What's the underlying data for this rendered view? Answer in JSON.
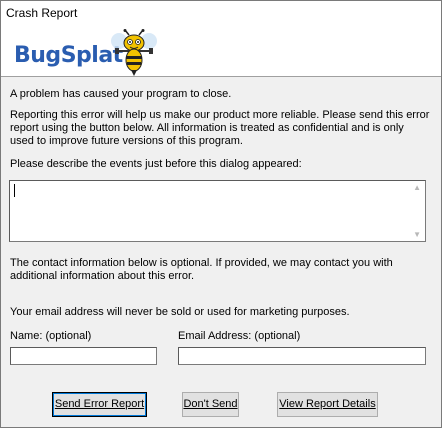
{
  "window": {
    "title": "Crash Report"
  },
  "header": {
    "logo_part1": "Bug",
    "logo_part2": "Splat",
    "mascot_icon": "bee-mascot-icon"
  },
  "body": {
    "problem_text": "A problem has caused your program to close.",
    "reporting_line1": "Reporting this error will help us make our product more reliable.  Please send this error",
    "reporting_line2": "report using the button below.  All information is treated as confidential and is only",
    "reporting_line3": "used to improve future versions of this program.",
    "describe_label": "Please describe the events just before this dialog appeared:",
    "description_value": "",
    "contact_line1": "The contact information below is optional. If provided, we may contact you with",
    "contact_line2": "additional information about this error.",
    "privacy_text": "Your email address will never be sold or used for marketing purposes.",
    "name_label": "Name: (optional)",
    "name_value": "",
    "email_label": "Email Address: (optional)",
    "email_value": ""
  },
  "buttons": {
    "send": "Send Error Report",
    "dont_send": "Don't Send",
    "details": "View Report Details"
  }
}
